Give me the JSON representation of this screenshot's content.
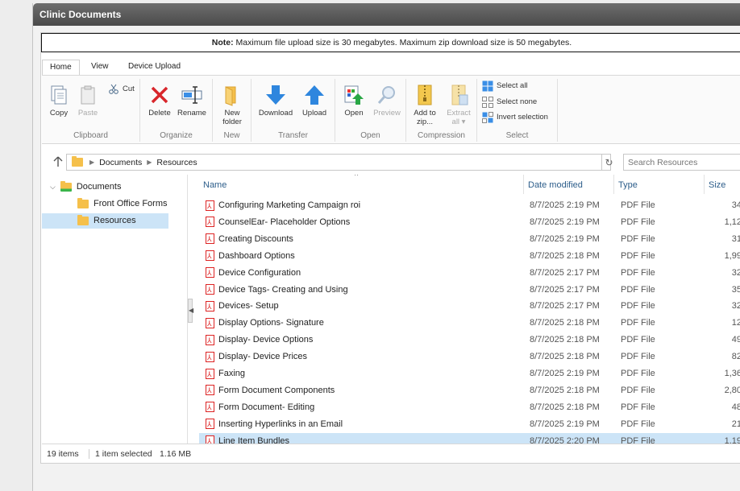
{
  "window": {
    "title": "Clinic Documents"
  },
  "note": {
    "label": "Note:",
    "text": " Maximum file upload size is 30 megabytes. Maximum zip download size is 50 megabytes."
  },
  "tabs": [
    {
      "label": "Home"
    },
    {
      "label": "View"
    },
    {
      "label": "Device Upload"
    }
  ],
  "ribbon": {
    "clipboard": {
      "label": "Clipboard",
      "copy": "Copy",
      "paste": "Paste",
      "cut": "Cut"
    },
    "organize": {
      "label": "Organize",
      "delete": "Delete",
      "rename": "Rename"
    },
    "new": {
      "label": "New",
      "new_folder_1": "New",
      "new_folder_2": "folder"
    },
    "transfer": {
      "label": "Transfer",
      "download": "Download",
      "upload": "Upload"
    },
    "open": {
      "label": "Open",
      "open": "Open",
      "preview": "Preview"
    },
    "compression": {
      "label": "Compression",
      "add_1": "Add to",
      "add_2": "zip...",
      "extract_1": "Extract",
      "extract_2": "all ▾"
    },
    "select": {
      "label": "Select",
      "select_all": "Select all",
      "select_none": "Select none",
      "invert": "Invert selection"
    }
  },
  "breadcrumb": [
    "Documents",
    "Resources"
  ],
  "search": {
    "placeholder": "Search Resources"
  },
  "tree": {
    "root": "Documents",
    "children": [
      "Front Office Forms",
      "Resources"
    ]
  },
  "columns": {
    "name": "Name",
    "date": "Date modified",
    "type": "Type",
    "size": "Size"
  },
  "files": [
    {
      "name": "Configuring Marketing Campaign roi",
      "date": "8/7/2025 2:19 PM",
      "type": "PDF File",
      "size": "34"
    },
    {
      "name": "CounselEar- Placeholder Options",
      "date": "8/7/2025 2:19 PM",
      "type": "PDF File",
      "size": "1,12"
    },
    {
      "name": "Creating Discounts",
      "date": "8/7/2025 2:19 PM",
      "type": "PDF File",
      "size": "31"
    },
    {
      "name": "Dashboard Options",
      "date": "8/7/2025 2:18 PM",
      "type": "PDF File",
      "size": "1,99"
    },
    {
      "name": "Device Configuration",
      "date": "8/7/2025 2:17 PM",
      "type": "PDF File",
      "size": "32"
    },
    {
      "name": "Device Tags- Creating and Using",
      "date": "8/7/2025 2:17 PM",
      "type": "PDF File",
      "size": "35"
    },
    {
      "name": "Devices- Setup",
      "date": "8/7/2025 2:17 PM",
      "type": "PDF File",
      "size": "32"
    },
    {
      "name": "Display Options- Signature",
      "date": "8/7/2025 2:18 PM",
      "type": "PDF File",
      "size": "12"
    },
    {
      "name": "Display- Device Options",
      "date": "8/7/2025 2:18 PM",
      "type": "PDF File",
      "size": "49"
    },
    {
      "name": "Display- Device Prices",
      "date": "8/7/2025 2:18 PM",
      "type": "PDF File",
      "size": "82"
    },
    {
      "name": "Faxing",
      "date": "8/7/2025 2:19 PM",
      "type": "PDF File",
      "size": "1,36"
    },
    {
      "name": "Form Document Components",
      "date": "8/7/2025 2:18 PM",
      "type": "PDF File",
      "size": "2,80"
    },
    {
      "name": "Form Document- Editing",
      "date": "8/7/2025 2:18 PM",
      "type": "PDF File",
      "size": "48"
    },
    {
      "name": "Inserting Hyperlinks in an Email",
      "date": "8/7/2025 2:19 PM",
      "type": "PDF File",
      "size": "21"
    },
    {
      "name": "Line Item Bundles",
      "date": "8/7/2025 2:20 PM",
      "type": "PDF File",
      "size": "1,19"
    }
  ],
  "selected_index": 14,
  "status": {
    "items": "19 items",
    "selection": "1 item selected",
    "size": "1.16 MB"
  },
  "colors": {
    "accent": "#1e7fd8",
    "selection": "#cce4f7",
    "folder": "#f5c04b",
    "pdf": "#d22222"
  }
}
